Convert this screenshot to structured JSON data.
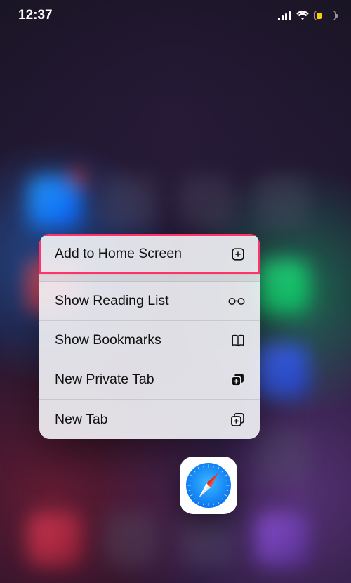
{
  "status": {
    "time": "12:37",
    "signal_bars": 4,
    "battery_pct": 28,
    "battery_color": "#ffcc00",
    "low_power": true,
    "wifi": true
  },
  "context_menu": {
    "app_name": "Safari",
    "highlighted_index": 0,
    "items": [
      {
        "label": "Add to Home Screen",
        "icon": "add-to-home-icon"
      },
      {
        "label": "Show Reading List",
        "icon": "glasses-icon"
      },
      {
        "label": "Show Bookmarks",
        "icon": "book-icon"
      },
      {
        "label": "New Private Tab",
        "icon": "private-tab-icon"
      },
      {
        "label": "New Tab",
        "icon": "new-tab-icon"
      }
    ]
  },
  "annotation": {
    "highlight_color": "#ff3569"
  }
}
